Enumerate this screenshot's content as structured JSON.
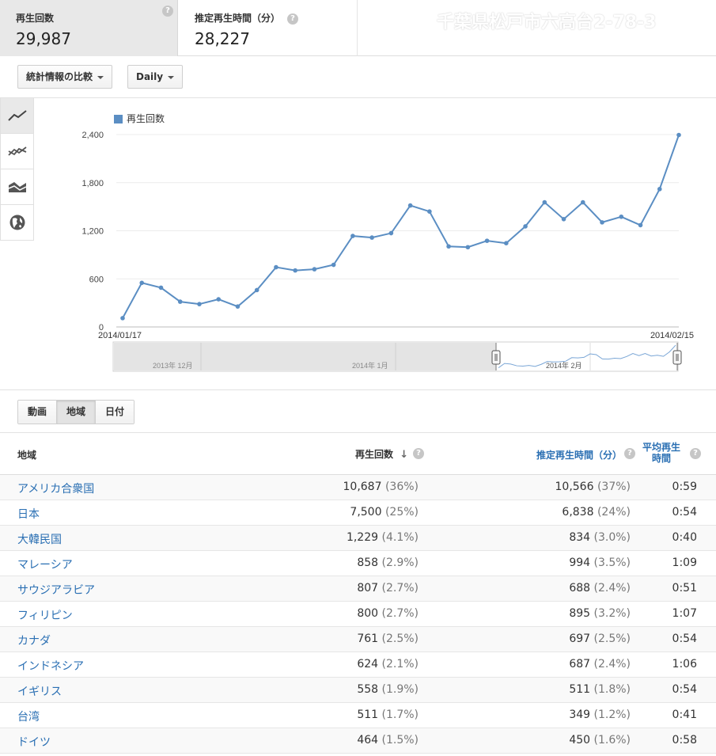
{
  "metrics": [
    {
      "label": "再生回数",
      "value": "29,987"
    },
    {
      "label": "推定再生時間（分）",
      "value": "28,227"
    }
  ],
  "watermark": "千葉県松戸市六高台2-78-3",
  "toolbar": {
    "compare_label": "統計情報の比較",
    "interval_label": "Daily"
  },
  "chart_tools": [
    "line-chart-icon",
    "multiline-chart-icon",
    "stacked-area-icon",
    "globe-map-icon"
  ],
  "colors": {
    "series": "#5b8ec3",
    "link": "#2a6fb3",
    "active_tab": "#e8e8e8"
  },
  "chart_data": {
    "type": "line",
    "legend": "再生回数",
    "y_ticks": [
      "2,400",
      "1,800",
      "1,200",
      "600",
      "0"
    ],
    "y_tick_values": [
      2400,
      1800,
      1200,
      600,
      0
    ],
    "ylim": [
      0,
      2400
    ],
    "x_start_label": "2014/01/17",
    "x_end_label": "2014/02/15",
    "values": [
      110,
      550,
      490,
      315,
      285,
      345,
      255,
      460,
      745,
      705,
      720,
      775,
      1135,
      1115,
      1170,
      1515,
      1440,
      1005,
      995,
      1075,
      1045,
      1255,
      1555,
      1345,
      1555,
      1305,
      1375,
      1270,
      1720,
      2395
    ],
    "navigator_labels": [
      "2013年 12月",
      "2014年 1月",
      "2014年 2月"
    ]
  },
  "dimension_tabs": [
    {
      "label": "動画",
      "active": false
    },
    {
      "label": "地域",
      "active": true
    },
    {
      "label": "日付",
      "active": false
    }
  ],
  "table": {
    "headers": {
      "region": "地域",
      "views": "再生回数",
      "watch_time": "推定再生時間（分）",
      "avg_line1": "平均再生",
      "avg_line2": "時間"
    },
    "rows": [
      {
        "region": "アメリカ合衆国",
        "views": "10,687",
        "views_pct": "(36%)",
        "watch": "10,566",
        "watch_pct": "(37%)",
        "avg": "0:59"
      },
      {
        "region": "日本",
        "views": "7,500",
        "views_pct": "(25%)",
        "watch": "6,838",
        "watch_pct": "(24%)",
        "avg": "0:54"
      },
      {
        "region": "大韓民国",
        "views": "1,229",
        "views_pct": "(4.1%)",
        "watch": "834",
        "watch_pct": "(3.0%)",
        "avg": "0:40"
      },
      {
        "region": "マレーシア",
        "views": "858",
        "views_pct": "(2.9%)",
        "watch": "994",
        "watch_pct": "(3.5%)",
        "avg": "1:09"
      },
      {
        "region": "サウジアラビア",
        "views": "807",
        "views_pct": "(2.7%)",
        "watch": "688",
        "watch_pct": "(2.4%)",
        "avg": "0:51"
      },
      {
        "region": "フィリピン",
        "views": "800",
        "views_pct": "(2.7%)",
        "watch": "895",
        "watch_pct": "(3.2%)",
        "avg": "1:07"
      },
      {
        "region": "カナダ",
        "views": "761",
        "views_pct": "(2.5%)",
        "watch": "697",
        "watch_pct": "(2.5%)",
        "avg": "0:54"
      },
      {
        "region": "インドネシア",
        "views": "624",
        "views_pct": "(2.1%)",
        "watch": "687",
        "watch_pct": "(2.4%)",
        "avg": "1:06"
      },
      {
        "region": "イギリス",
        "views": "558",
        "views_pct": "(1.9%)",
        "watch": "511",
        "watch_pct": "(1.8%)",
        "avg": "0:54"
      },
      {
        "region": "台湾",
        "views": "511",
        "views_pct": "(1.7%)",
        "watch": "349",
        "watch_pct": "(1.2%)",
        "avg": "0:41"
      },
      {
        "region": "ドイツ",
        "views": "464",
        "views_pct": "(1.5%)",
        "watch": "450",
        "watch_pct": "(1.6%)",
        "avg": "0:58"
      }
    ]
  }
}
